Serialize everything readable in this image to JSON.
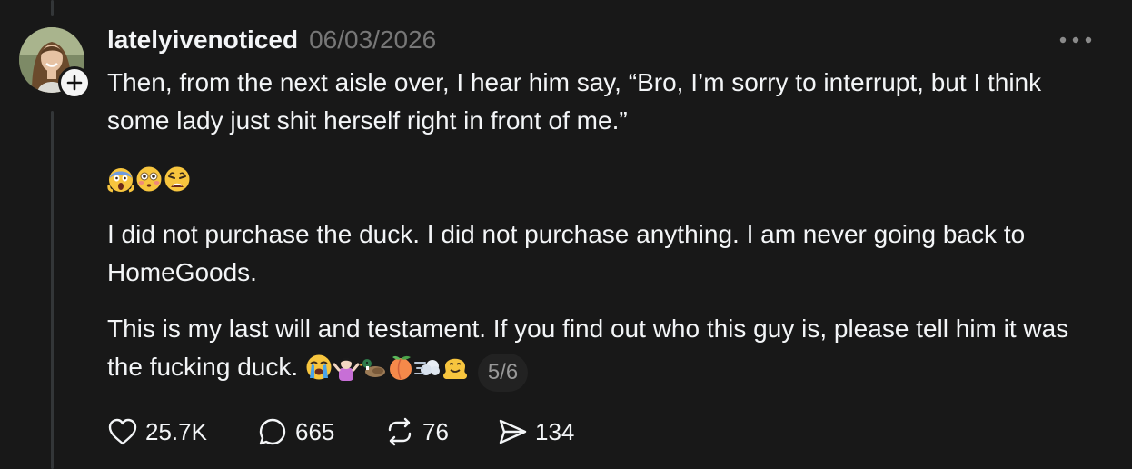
{
  "post": {
    "author": "latelyivenoticed",
    "date": "06/03/2026",
    "paragraph1": "Then, from the next aisle over, I hear him say, “Bro, I’m sorry to interrupt, but I think some lady just shit herself right in front of me.”",
    "paragraph3": "I did not purchase the duck. I did not purchase anything. I am never going back to HomeGoods.",
    "paragraph4": "This is my last will and testament. If you find out who this guy is, please tell him it was the fucking duck.",
    "reaction_emojis": [
      "face-screaming-in-fear-emoji",
      "flushed-face-emoji",
      "weary-face-emoji"
    ],
    "trailing_emojis": [
      "loudly-crying-face-emoji",
      "person-shrugging-emoji",
      "duck-emoji",
      "peach-emoji",
      "dashing-away-emoji",
      "melting-face-emoji"
    ],
    "page_indicator": "5/6"
  },
  "actions": {
    "likes": "25.7K",
    "replies": "665",
    "reposts": "76",
    "shares": "134"
  },
  "icons": {
    "follow": "plus-icon",
    "more": "more-horizontal-icon",
    "like": "heart-icon",
    "reply": "comment-bubble-icon",
    "repost": "repost-icon",
    "share": "send-icon"
  },
  "colors": {
    "background": "#181818",
    "text_primary": "#f3f5f7",
    "text_secondary": "#777777",
    "thread_line": "#333638",
    "pill_background": "#222222"
  }
}
